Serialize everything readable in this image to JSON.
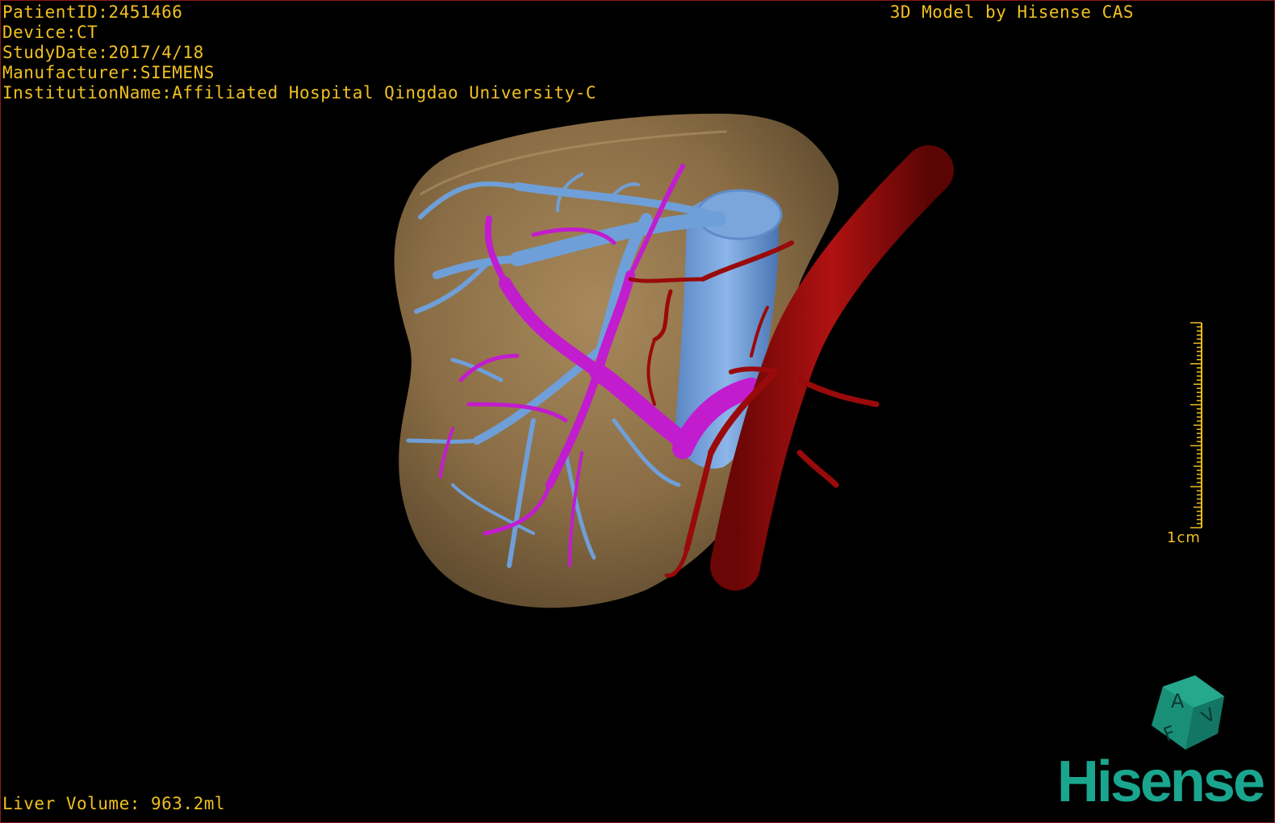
{
  "overlay": {
    "patient_id": "PatientID:2451466",
    "device": "Device:CT",
    "study_date": "StudyDate:2017/4/18",
    "manufacturer": "Manufacturer:SIEMENS",
    "institution": "InstitutionName:Affiliated Hospital Qingdao University-C",
    "title": "3D Model by Hisense CAS",
    "volume": "Liver Volume: 963.2ml"
  },
  "scale": {
    "label": "1cm"
  },
  "orientation_cube": {
    "letters": [
      "A",
      "F",
      "V"
    ]
  },
  "brand": {
    "logo_text": "Hisense"
  },
  "colors": {
    "overlay_text": "#f0c020",
    "liver": "#8a6d45",
    "hepatic_vein": "#6f9fd8",
    "portal_vein": "#c21ccf",
    "artery": "#9a0a0a",
    "brand": "#1aa58e",
    "border": "#8a1a1a"
  },
  "icons": [
    "orientation-cube-icon",
    "scale-bar-icon"
  ]
}
